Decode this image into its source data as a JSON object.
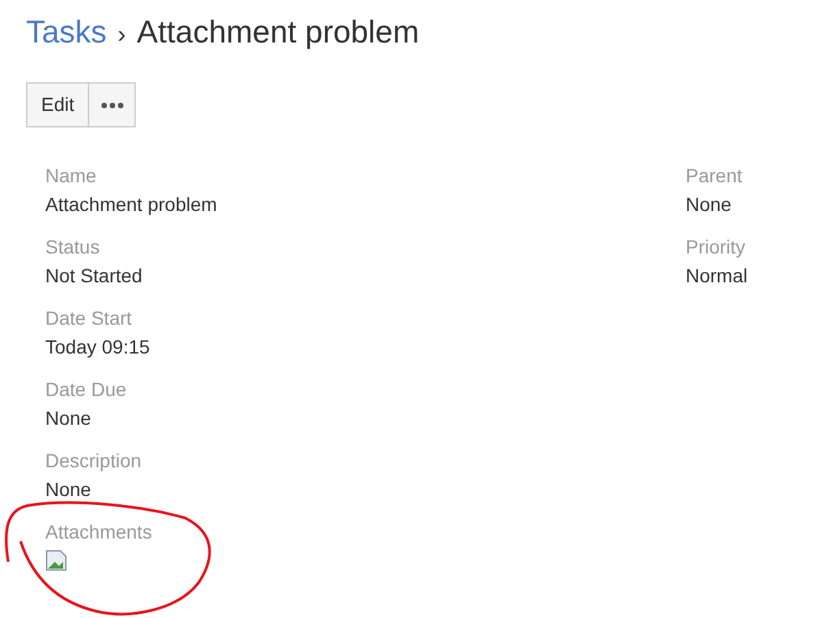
{
  "breadcrumb": {
    "parent": "Tasks",
    "separator": "›",
    "title": "Attachment problem"
  },
  "toolbar": {
    "edit_label": "Edit"
  },
  "fields_left": [
    {
      "label": "Name",
      "value": "Attachment problem"
    },
    {
      "label": "Status",
      "value": "Not Started"
    },
    {
      "label": "Date Start",
      "value": "Today 09:15"
    },
    {
      "label": "Date Due",
      "value": "None"
    },
    {
      "label": "Description",
      "value": "None"
    }
  ],
  "fields_right": [
    {
      "label": "Parent",
      "value": "None"
    },
    {
      "label": "Priority",
      "value": "Normal"
    }
  ],
  "attachments": {
    "label": "Attachments",
    "items": [
      {
        "kind": "broken-image"
      }
    ]
  }
}
